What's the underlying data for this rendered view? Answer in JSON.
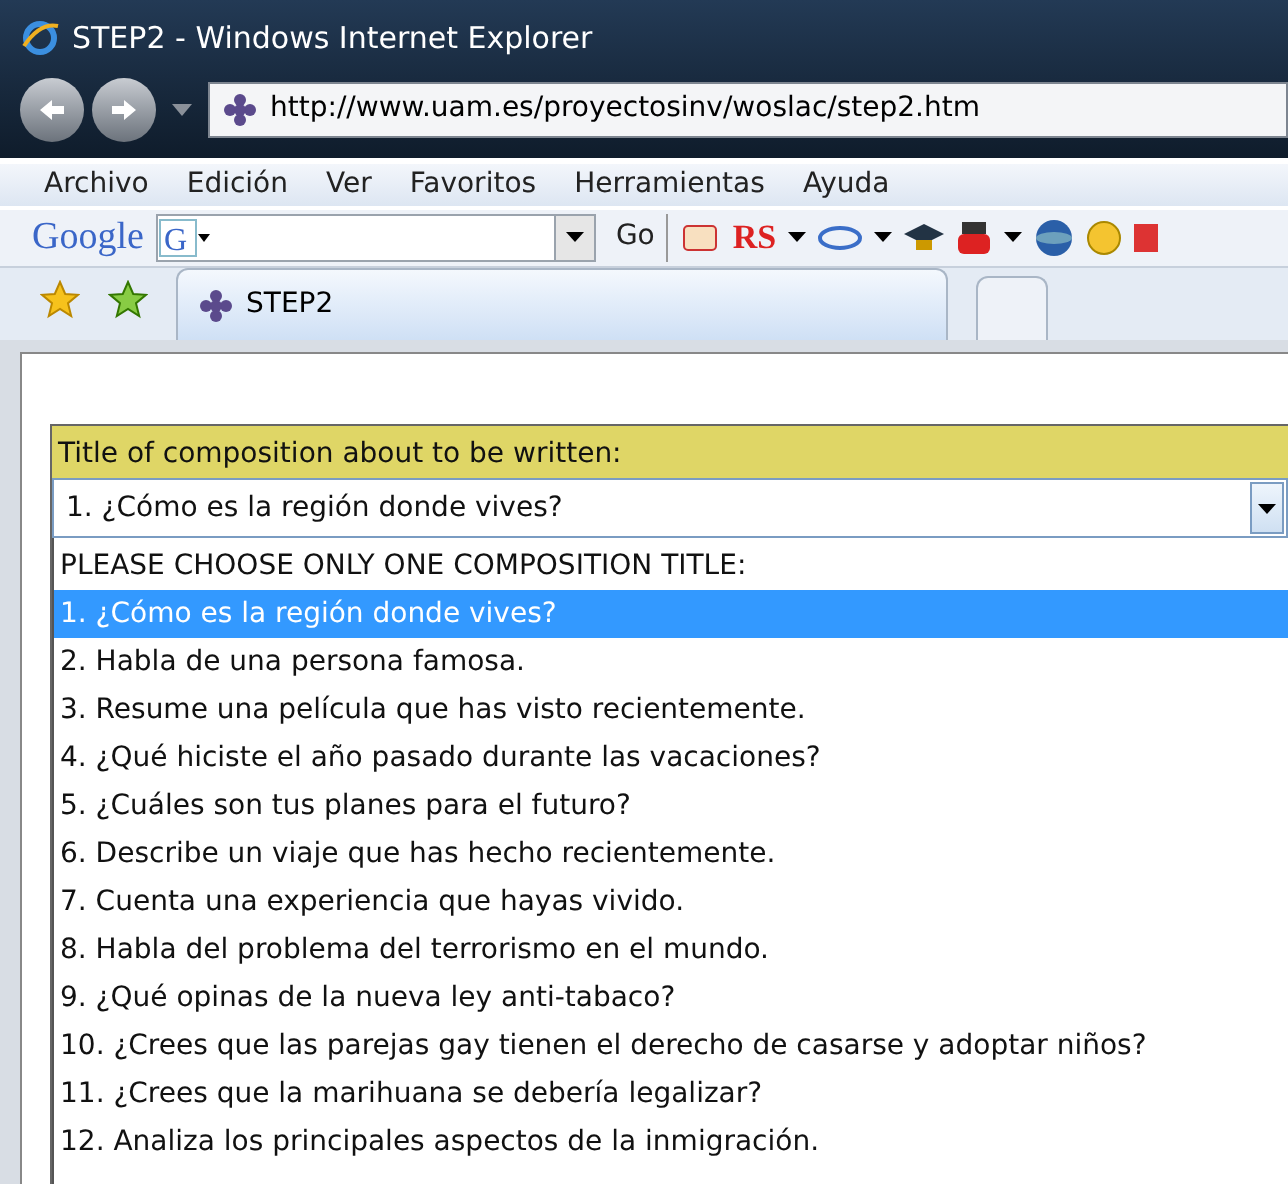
{
  "window": {
    "title": "STEP2 - Windows Internet Explorer"
  },
  "address": {
    "value": "http://www.uam.es/proyectosinv/woslac/step2.htm"
  },
  "menu": [
    "Archivo",
    "Edición",
    "Ver",
    "Favoritos",
    "Herramientas",
    "Ayuda"
  ],
  "toolbar": {
    "brand": "Google",
    "g": "G",
    "go": "Go",
    "rs": "RS"
  },
  "tabs": [
    {
      "label": "STEP2",
      "selected": true
    }
  ],
  "form": {
    "label": "Title of composition about to be written:",
    "value": "1. ¿Cómo es la región donde vives?",
    "options": [
      {
        "label": "PLEASE CHOOSE ONLY ONE COMPOSITION TITLE:",
        "selected": false
      },
      {
        "label": "1. ¿Cómo es la región donde vives?",
        "selected": true
      },
      {
        "label": "2. Habla de una persona famosa.",
        "selected": false
      },
      {
        "label": "3. Resume una película que has visto recientemente.",
        "selected": false
      },
      {
        "label": "4. ¿Qué hiciste el año pasado durante las vacaciones?",
        "selected": false
      },
      {
        "label": "5. ¿Cuáles son tus planes para el futuro?",
        "selected": false
      },
      {
        "label": "6. Describe un viaje que has hecho recientemente.",
        "selected": false
      },
      {
        "label": "7. Cuenta una experiencia que hayas vivido.",
        "selected": false
      },
      {
        "label": "8. Habla del problema del terrorismo en el mundo.",
        "selected": false
      },
      {
        "label": "9. ¿Qué opinas de la nueva ley anti-tabaco?",
        "selected": false
      },
      {
        "label": "10. ¿Crees que las parejas gay tienen el derecho de casarse y adoptar niños?",
        "selected": false
      },
      {
        "label": "11. ¿Crees que la marihuana se debería legalizar?",
        "selected": false
      },
      {
        "label": "12. Analiza los principales aspectos de la inmigración.",
        "selected": false
      }
    ]
  }
}
